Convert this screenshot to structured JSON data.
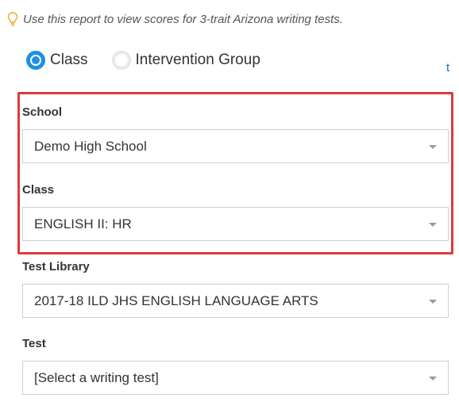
{
  "hint": {
    "icon": "lightbulb-icon",
    "text": "Use this report to view scores for 3-trait Arizona writing tests."
  },
  "group_type": {
    "options": [
      {
        "label": "Class",
        "selected": true
      },
      {
        "label": "Intervention Group",
        "selected": false
      }
    ]
  },
  "edge_glyph": "t",
  "fields": {
    "school": {
      "label": "School",
      "value": "Demo High School"
    },
    "class": {
      "label": "Class",
      "value": "ENGLISH II: HR"
    },
    "test_library": {
      "label": "Test Library",
      "value": "2017-18 ILD JHS ENGLISH LANGUAGE ARTS"
    },
    "test": {
      "label": "Test",
      "value": "[Select a writing test]"
    }
  },
  "colors": {
    "accent": "#1f8fe0",
    "highlight_border": "#e0393c",
    "hint_icon": "#f0a830"
  }
}
